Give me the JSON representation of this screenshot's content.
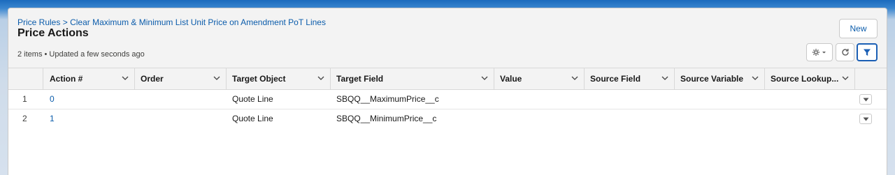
{
  "breadcrumb": {
    "parent": "Price Rules",
    "separator": ">",
    "current": "Clear Maximum & Minimum List Unit Price on Amendment PoT Lines"
  },
  "title": "Price Actions",
  "meta": "2 items • Updated a few seconds ago",
  "actions": {
    "new_label": "New"
  },
  "toolbar": {
    "settings_icon": "gear-icon",
    "refresh_icon": "refresh-icon",
    "filter_icon": "filter-icon"
  },
  "table": {
    "columns": [
      "Action #",
      "Order",
      "Target Object",
      "Target Field",
      "Value",
      "Source Field",
      "Source Variable",
      "Source Lookup..."
    ],
    "rows": [
      {
        "num": "1",
        "action": "0",
        "order": "",
        "target_object": "Quote Line",
        "target_field": "SBQQ__MaximumPrice__c",
        "value": "",
        "source_field": "",
        "source_variable": "",
        "source_lookup": ""
      },
      {
        "num": "2",
        "action": "1",
        "order": "",
        "target_object": "Quote Line",
        "target_field": "SBQQ__MinimumPrice__c",
        "value": "",
        "source_field": "",
        "source_variable": "",
        "source_lookup": ""
      }
    ]
  },
  "colors": {
    "link": "#0b5cab",
    "accent": "#1b5fb5",
    "header_bg": "#1c6bbd"
  }
}
